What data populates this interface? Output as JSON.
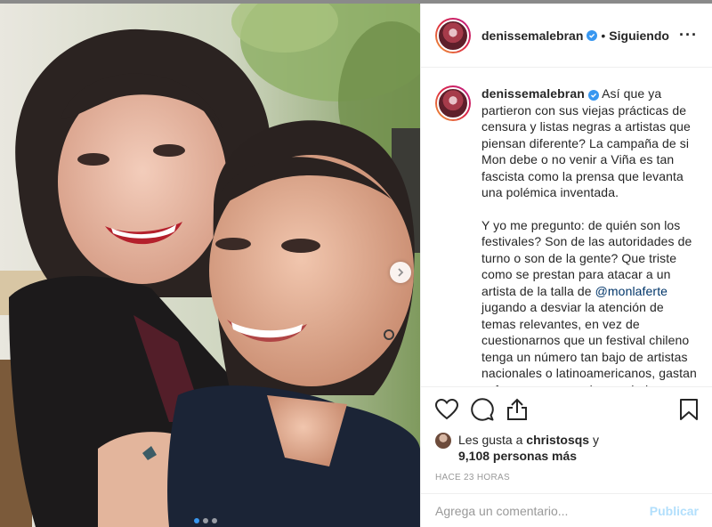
{
  "post": {
    "username": "denissemalebran",
    "follow_separator": "•",
    "follow_status": "Siguiendo",
    "more_icon": "more-dots-icon",
    "verified_icon": "verified-badge-icon"
  },
  "caption": {
    "paragraph_1": "Así que ya partieron con sus viejas prácticas de censura y listas negras a artistas que piensan diferente? La campaña de si Mon debe o no venir a Viña es tan fascista como la prensa que levanta una polémica inventada.",
    "paragraph_2_before": "Y yo me pregunto: de quién son los festivales? Son de las autoridades de turno o son de la gente? Que triste como se prestan para atacar a un artista de la talla de ",
    "mention": "@monlaferte",
    "paragraph_2_after": " jugando a desviar la atención de temas relevantes, en vez de cuestionarnos que un festival chileno tenga un número tan bajo de artistas nacionales o latinoamericanos, gastan esfuerzos en ponerlos en duda."
  },
  "actions": {
    "like_icon": "heart-icon",
    "comment_icon": "comment-icon",
    "share_icon": "share-icon",
    "save_icon": "bookmark-icon"
  },
  "likes": {
    "prefix": "Les gusta a",
    "user": "christosqs",
    "connector": "y",
    "count_text": "9,108 personas más"
  },
  "timestamp": "HACE 23 HORAS",
  "comment_box": {
    "placeholder": "Agrega un comentario...",
    "publish_label": "Publicar"
  },
  "carousel": {
    "total": 3,
    "active_index": 0
  },
  "colors": {
    "accent_blue": "#3897f0",
    "mention_blue": "#003569",
    "publish_disabled": "#b2dffc",
    "text": "#262626",
    "muted": "#999999"
  }
}
